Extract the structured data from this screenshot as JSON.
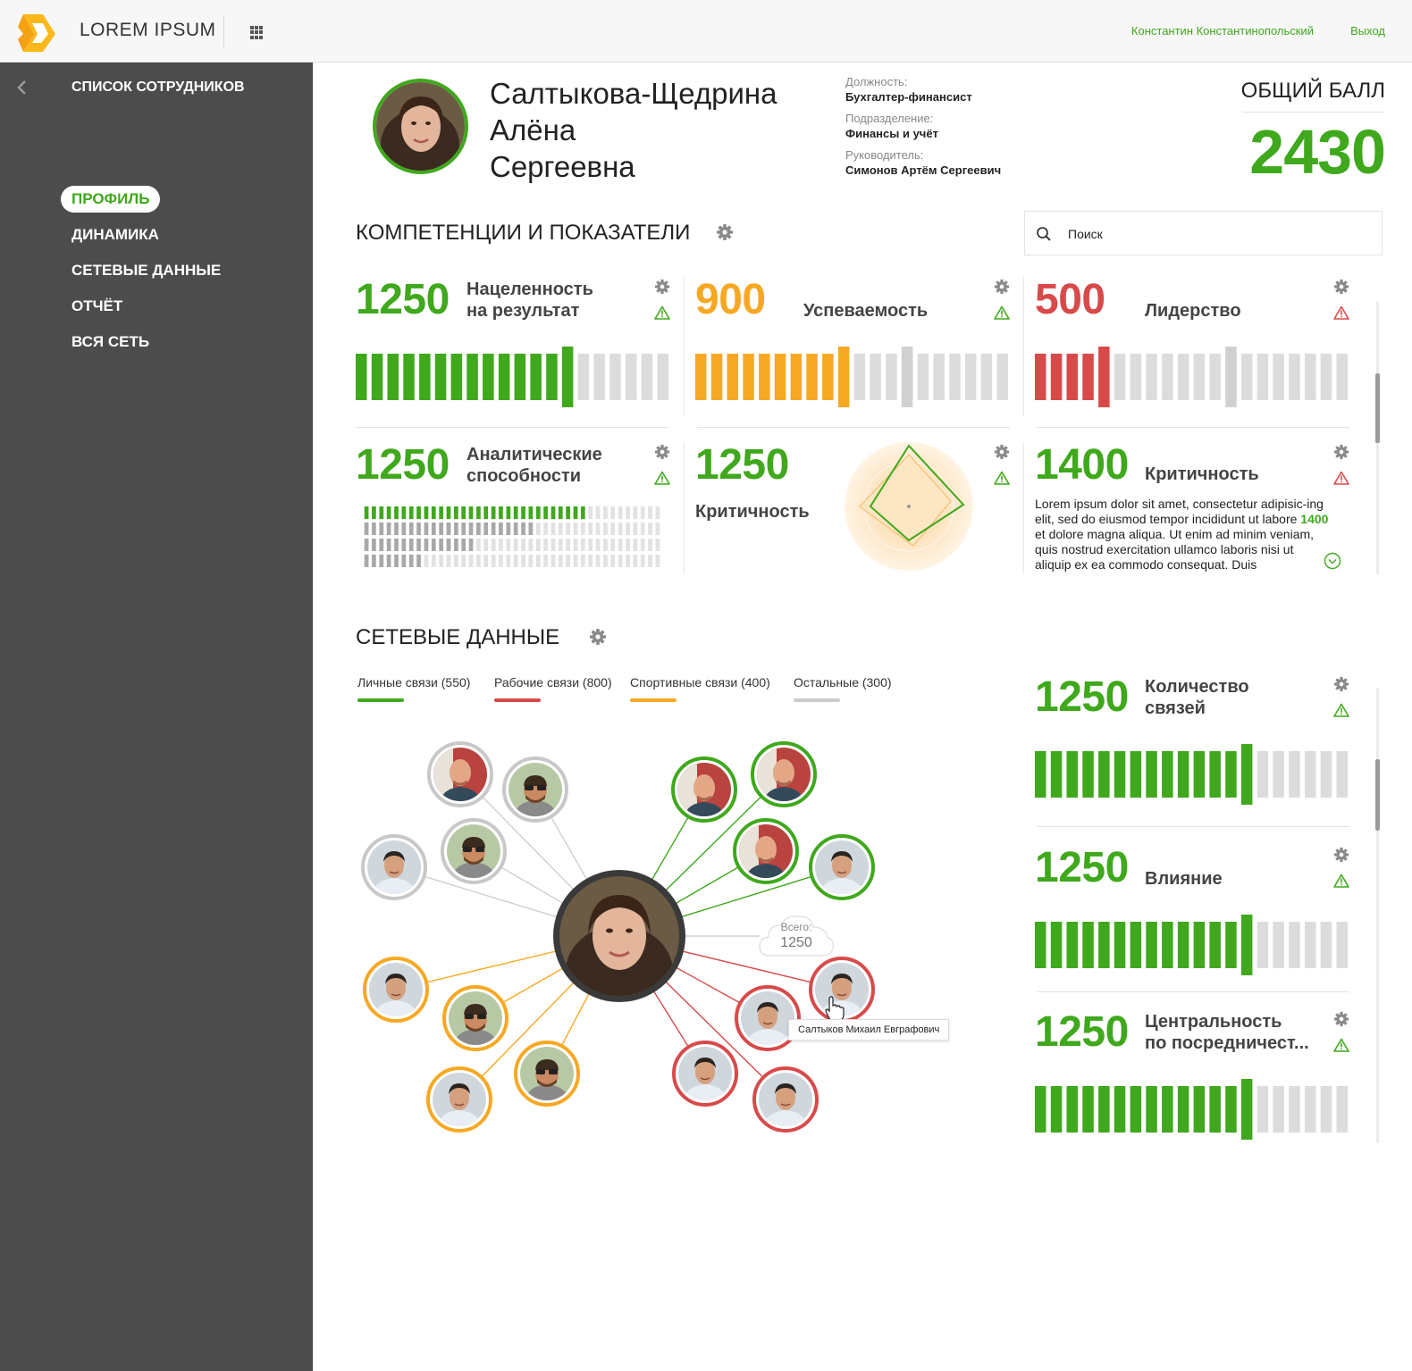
{
  "header": {
    "app_title": "LOREM IPSUM",
    "user_name": "Константин Константинопольский",
    "logout": "Выход"
  },
  "sidebar": {
    "title": "СПИСОК СОТРУДНИКОВ",
    "items": [
      {
        "label": "ПРОФИЛЬ",
        "active": true
      },
      {
        "label": "ДИНАМИКА"
      },
      {
        "label": "СЕТЕВЫЕ ДАННЫЕ"
      },
      {
        "label": "ОТЧЁТ"
      },
      {
        "label": "ВСЯ СЕТЬ"
      }
    ]
  },
  "profile": {
    "name_line1": "Салтыкова-Щедрина",
    "name_line2": "Алёна",
    "name_line3": "Сергеевна",
    "position_label": "Должность:",
    "position_value": "Бухгалтер-финансист",
    "department_label": "Подразделение:",
    "department_value": "Финансы и учёт",
    "manager_label": "Руководитель:",
    "manager_value": "Симонов Артём Сергеевич",
    "score_label": "ОБЩИЙ БАЛЛ",
    "score_value": "2430"
  },
  "competencies": {
    "title": "КОМПЕТЕНЦИИ И ПОКАЗАТЕЛИ",
    "search_placeholder": "Поиск",
    "cards": [
      {
        "value": "1250",
        "label1": "Нацеленность",
        "label2": "на результат",
        "color": "#3fa81c",
        "level": 0.72,
        "bars": 20
      },
      {
        "value": "900",
        "label1": "Успеваемость",
        "label2": "",
        "color": "#f7a823",
        "level": 0.5,
        "bars": 20
      },
      {
        "value": "500",
        "label1": "Лидерство",
        "label2": "",
        "color": "#d84a4a",
        "level": 0.25,
        "bars": 20
      },
      {
        "value": "1250",
        "label1": "Аналитические",
        "label2": "способности",
        "color": "#3fa81c",
        "rows": [
          0.74,
          0.57,
          0.38,
          0.2
        ]
      },
      {
        "value": "1250",
        "label1": "Критичность",
        "label2": "",
        "color": "#3fa81c"
      },
      {
        "value": "1400",
        "label1": "Критичность",
        "label2": "",
        "color": "#3fa81c",
        "text_before": "Lorem ipsum dolor sit amet, consectetur adipisic-ing elit, sed do eiusmod tempor incididunt ut labore ",
        "text_highlight": "1400",
        "text_after": " et dolore magna aliqua. Ut enim ad minim veniam, quis nostrud exercitation ullamco laboris nisi ut aliquip ex ea commodo consequat. Duis"
      }
    ]
  },
  "network": {
    "title": "СЕТЕВЫЕ ДАННЫЕ",
    "tabs": [
      {
        "label": "Личные связи (550)",
        "color": "#3fa81c"
      },
      {
        "label": "Рабочие связи (800)",
        "color": "#d84a4a"
      },
      {
        "label": "Спортивные связи (400)",
        "color": "#f7a823"
      },
      {
        "label": "Остальные (300)",
        "color": "#cccccc"
      }
    ],
    "total_label": "Всего:",
    "total_value": "1250",
    "tooltip": "Салтыков Михаил Евграфович",
    "metrics": [
      {
        "value": "1250",
        "label1": "Количество",
        "label2": "связей",
        "level": 0.69,
        "bars": 20
      },
      {
        "value": "1250",
        "label1": "Влияние",
        "label2": "",
        "level": 0.69,
        "bars": 20
      },
      {
        "value": "1250",
        "label1": "Центральность",
        "label2": "по посредничест...",
        "level": 0.69,
        "bars": 20
      }
    ]
  },
  "colors": {
    "green": "#3fa81c",
    "orange": "#f7a823",
    "red": "#d84a4a",
    "gray": "#cccccc",
    "sidebar": "#4c4c4c"
  },
  "icons": [
    "logo-icon",
    "apps-grid-icon",
    "chevron-left-icon",
    "gear-icon",
    "warning-icon",
    "search-icon",
    "chevron-down-icon",
    "cloud-icon",
    "hand-cursor-icon",
    "avatar"
  ]
}
